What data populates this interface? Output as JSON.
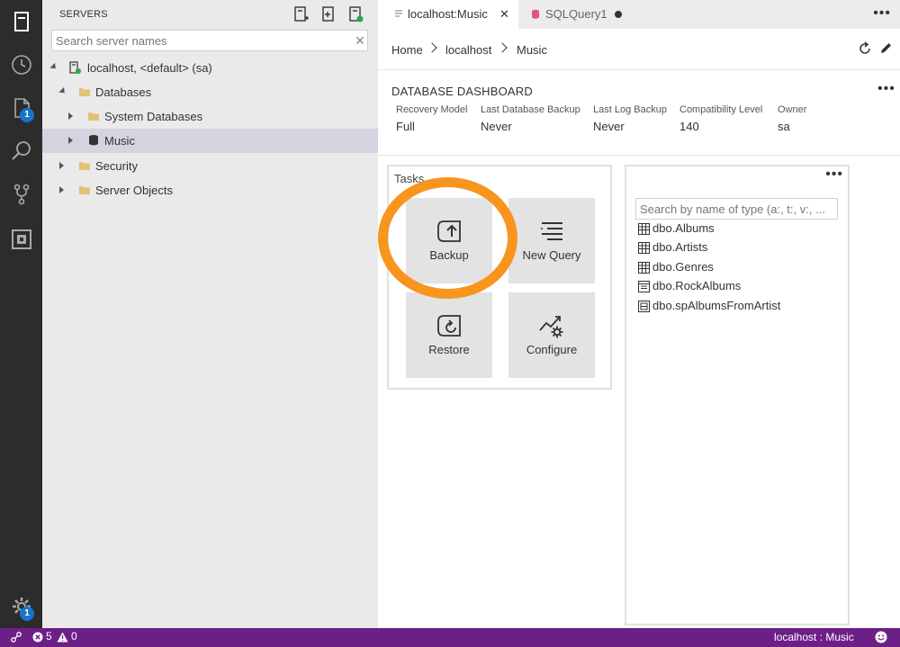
{
  "activity_bar": {
    "items": [
      {
        "name": "servers-icon"
      },
      {
        "name": "history-icon"
      },
      {
        "name": "file-icon",
        "badge": "1"
      },
      {
        "name": "search-icon"
      },
      {
        "name": "source-control-icon"
      },
      {
        "name": "extensions-icon"
      }
    ],
    "settings_badge": "1"
  },
  "sidebar": {
    "title": "SERVERS",
    "search_placeholder": "Search server names",
    "tree": [
      {
        "label": "localhost, <default> (sa)",
        "icon": "server-icon",
        "state": "expanded"
      },
      {
        "label": "Databases",
        "icon": "folder-icon",
        "state": "expanded"
      },
      {
        "label": "System Databases",
        "icon": "folder-icon",
        "state": "collapsed"
      },
      {
        "label": "Music",
        "icon": "database-icon",
        "state": "collapsed",
        "selected": true
      },
      {
        "label": "Security",
        "icon": "folder-icon",
        "state": "collapsed"
      },
      {
        "label": "Server Objects",
        "icon": "folder-icon",
        "state": "collapsed"
      }
    ]
  },
  "tabs": [
    {
      "label": "localhost:Music",
      "active": true
    },
    {
      "label": "SQLQuery1",
      "active": false,
      "dirty": true
    }
  ],
  "tabs_more": "•••",
  "breadcrumb": [
    "Home",
    "localhost",
    "Music"
  ],
  "dashboard": {
    "title": "DATABASE DASHBOARD",
    "more": "•••",
    "properties": [
      {
        "label": "Recovery Model",
        "value": "Full"
      },
      {
        "label": "Last Database Backup",
        "value": "Never"
      },
      {
        "label": "Last Log Backup",
        "value": "Never"
      },
      {
        "label": "Compatibility Level",
        "value": "140"
      },
      {
        "label": "Owner",
        "value": "sa"
      }
    ],
    "tasks": {
      "title": "Tasks",
      "items": [
        {
          "label": "Backup",
          "icon": "backup-icon"
        },
        {
          "label": "New Query",
          "icon": "new-query-icon"
        },
        {
          "label": "Restore",
          "icon": "restore-icon"
        },
        {
          "label": "Configure",
          "icon": "configure-icon"
        }
      ]
    },
    "explorer": {
      "more": "•••",
      "search_placeholder": "Search by name of type (a:, t:, v:, ...",
      "items": [
        {
          "label": "dbo.Albums",
          "icon": "table-icon"
        },
        {
          "label": "dbo.Artists",
          "icon": "table-icon"
        },
        {
          "label": "dbo.Genres",
          "icon": "table-icon"
        },
        {
          "label": "dbo.RockAlbums",
          "icon": "view-icon"
        },
        {
          "label": "dbo.spAlbumsFromArtist",
          "icon": "procedure-icon"
        }
      ]
    }
  },
  "statusbar": {
    "errors": "5",
    "warnings": "0",
    "connection": "localhost : Music"
  },
  "colors": {
    "activity_bg": "#2c2c2c",
    "sidebar_bg": "#eaeaea",
    "selection": "#d3d4df",
    "statusbar_bg": "#6c1f87",
    "highlight": "#f7951e",
    "badge": "#1a73c9"
  }
}
